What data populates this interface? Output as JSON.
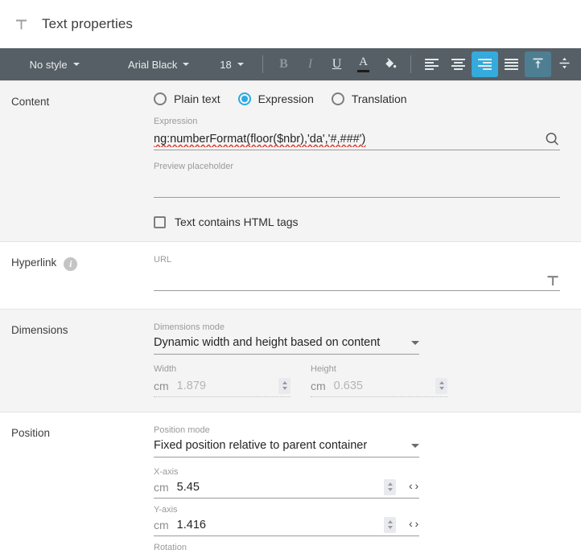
{
  "header": {
    "icon": "text-format-icon",
    "title": "Text properties"
  },
  "toolbar": {
    "style": {
      "label": "No style",
      "icon": "chevron-down-icon"
    },
    "font": {
      "label": "Arial Black",
      "icon": "chevron-down-icon"
    },
    "size": {
      "label": "18",
      "icon": "chevron-down-icon"
    },
    "bold": {
      "label": "B",
      "name": "bold-icon",
      "state": "disabled"
    },
    "italic": {
      "label": "I",
      "name": "italic-icon",
      "state": "disabled"
    },
    "underline": {
      "label": "U",
      "name": "underline-icon",
      "state": "normal"
    },
    "font_color": {
      "label": "A",
      "name": "font-color-icon",
      "swatch": "#1b1b1b"
    },
    "fill_color": {
      "label": "◢",
      "name": "fill-color-icon"
    },
    "align_left": {
      "name": "align-left-icon",
      "state": "normal"
    },
    "align_center": {
      "name": "align-center-icon",
      "state": "normal"
    },
    "align_right": {
      "name": "align-right-icon",
      "state": "active"
    },
    "align_justify": {
      "name": "align-justify-icon",
      "state": "normal"
    },
    "valign_top": {
      "name": "vertical-align-top-icon",
      "state": "active-muted"
    },
    "valign_middle": {
      "name": "vertical-align-middle-icon",
      "state": "normal"
    },
    "colors": {
      "bar_bg": "#555f65",
      "active_bright": "#35aadc",
      "active_muted": "#4e7e92"
    }
  },
  "sections": {
    "content": {
      "label": "Content",
      "options": [
        {
          "label": "Plain text",
          "checked": false
        },
        {
          "label": "Expression",
          "checked": true
        },
        {
          "label": "Translation",
          "checked": false
        }
      ],
      "expression": {
        "caption": "Expression",
        "value": "ng:numberFormat(floor($nbr),'da','#,###')",
        "search_icon": "search-icon"
      },
      "preview": {
        "caption": "Preview placeholder",
        "value": ""
      },
      "html_tags": {
        "label": "Text contains HTML tags",
        "checked": false
      }
    },
    "hyperlink": {
      "label": "Hyperlink",
      "info_icon": "info-icon",
      "url": {
        "caption": "URL",
        "value": "",
        "trailing_icon": "text-format-icon"
      }
    },
    "dimensions": {
      "label": "Dimensions",
      "mode": {
        "caption": "Dimensions mode",
        "value": "Dynamic width and height based on content",
        "icon": "chevron-down-icon"
      },
      "width": {
        "caption": "Width",
        "unit": "cm",
        "value": "1.879",
        "disabled": true,
        "stepper_icon": "stepper-icon"
      },
      "height": {
        "caption": "Height",
        "unit": "cm",
        "value": "0.635",
        "disabled": true,
        "stepper_icon": "stepper-icon"
      }
    },
    "position": {
      "label": "Position",
      "mode": {
        "caption": "Position mode",
        "value": "Fixed position relative to parent container",
        "icon": "chevron-down-icon"
      },
      "x_axis": {
        "caption": "X-axis",
        "unit": "cm",
        "value": "5.45",
        "stepper_icon": "stepper-icon",
        "expr_icon": "‹›"
      },
      "y_axis": {
        "caption": "Y-axis",
        "unit": "cm",
        "value": "1.416",
        "stepper_icon": "stepper-icon",
        "expr_icon": "‹›"
      },
      "clipped_caption": "Rotation"
    }
  }
}
